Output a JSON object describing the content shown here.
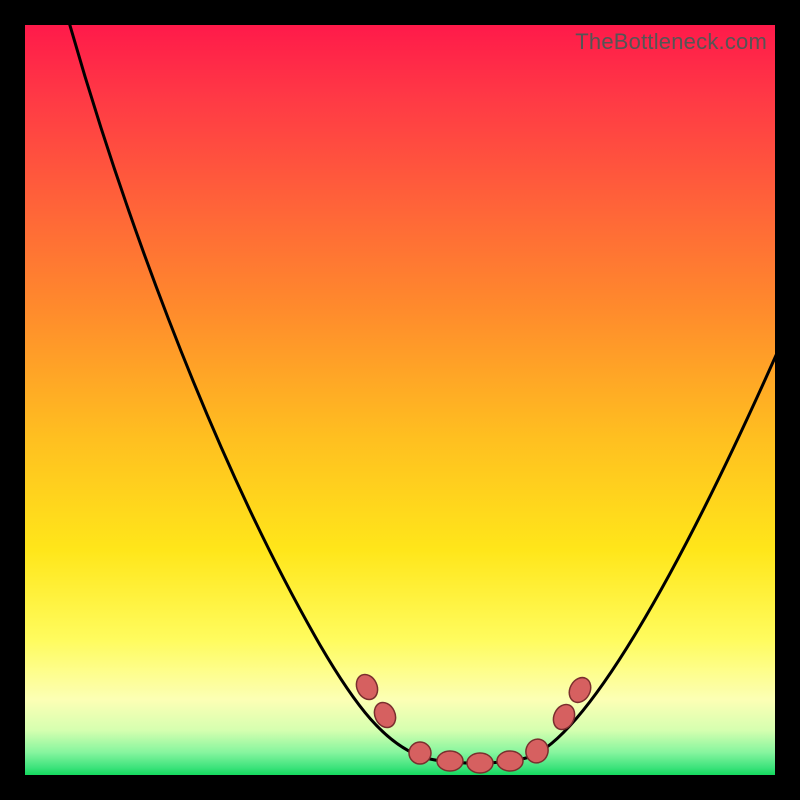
{
  "watermark": "TheBottleneck.com",
  "colors": {
    "background": "#000000",
    "gradient_top": "#ff1a4a",
    "gradient_bottom": "#14d95e",
    "curve": "#000000",
    "marker_fill": "#d66060",
    "marker_stroke": "#7a2e2e"
  },
  "chart_data": {
    "type": "line",
    "title": "",
    "xlabel": "",
    "ylabel": "",
    "xlim": [
      0,
      100
    ],
    "ylim": [
      0,
      100
    ],
    "x": [
      5,
      10,
      15,
      20,
      25,
      30,
      35,
      40,
      45,
      48,
      50,
      53,
      55,
      58,
      60,
      65,
      70,
      75,
      80,
      85,
      90,
      95,
      100
    ],
    "values": [
      100,
      87,
      74,
      62,
      50,
      39,
      29,
      20,
      12,
      8,
      5,
      2,
      1,
      0,
      0,
      0,
      3,
      9,
      18,
      28,
      40,
      53,
      67
    ],
    "markers_x": [
      45,
      47,
      53,
      56,
      59,
      62,
      65,
      68,
      70,
      72
    ],
    "markers_y": [
      12,
      9,
      2,
      1,
      0,
      0,
      0,
      1,
      3,
      6
    ]
  }
}
